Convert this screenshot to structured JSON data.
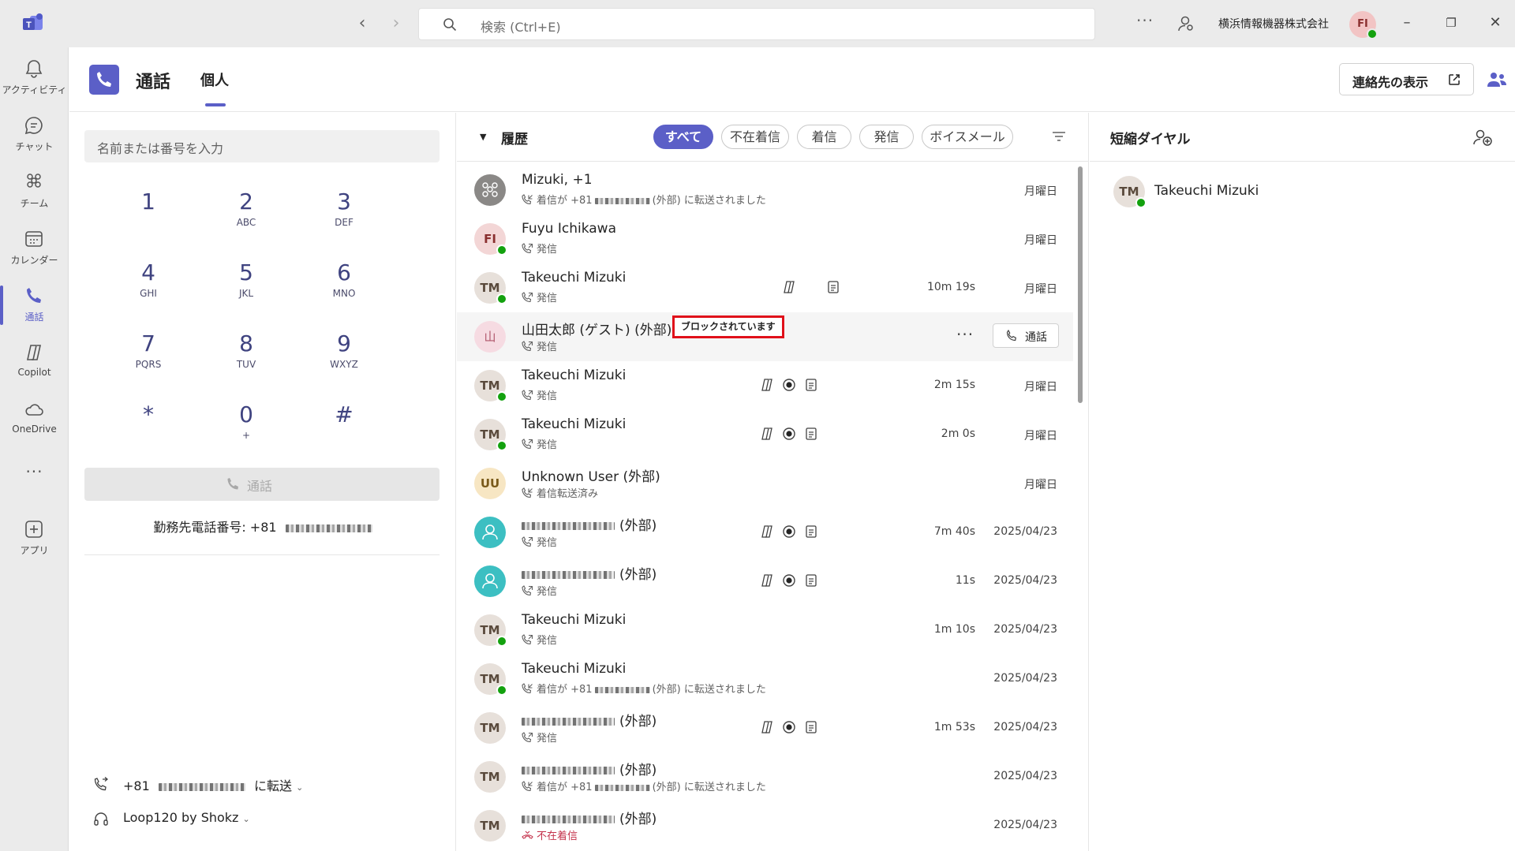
{
  "titlebar": {
    "search_placeholder": "検索 (Ctrl+E)",
    "org_name": "横浜情報機器株式会社",
    "avatar_initials": "FI"
  },
  "rail": {
    "items": [
      {
        "label": "アクティビティ",
        "icon": "bell-icon"
      },
      {
        "label": "チャット",
        "icon": "chat-icon"
      },
      {
        "label": "チーム",
        "icon": "teams-icon"
      },
      {
        "label": "カレンダー",
        "icon": "calendar-icon"
      },
      {
        "label": "通話",
        "icon": "phone-icon",
        "active": true
      },
      {
        "label": "Copilot",
        "icon": "copilot-icon"
      },
      {
        "label": "OneDrive",
        "icon": "cloud-icon"
      },
      {
        "label": "アプリ",
        "icon": "add-app-icon"
      }
    ],
    "more": "..."
  },
  "header": {
    "title": "通話",
    "tab": "個人",
    "show_contacts": "連絡先の表示"
  },
  "dialpad": {
    "placeholder": "名前または番号を入力",
    "keys": [
      {
        "d": "1",
        "l": ""
      },
      {
        "d": "2",
        "l": "ABC"
      },
      {
        "d": "3",
        "l": "DEF"
      },
      {
        "d": "4",
        "l": "GHI"
      },
      {
        "d": "5",
        "l": "JKL"
      },
      {
        "d": "6",
        "l": "MNO"
      },
      {
        "d": "7",
        "l": "PQRS"
      },
      {
        "d": "8",
        "l": "TUV"
      },
      {
        "d": "9",
        "l": "WXYZ"
      },
      {
        "d": "*",
        "l": ""
      },
      {
        "d": "0",
        "l": "+"
      },
      {
        "d": "#",
        "l": ""
      }
    ],
    "call_label": "通話",
    "work_number_label": "勤務先電話番号: +81",
    "forward_prefix": "+81",
    "forward_suffix": "に転送",
    "device": "Loop120 by Shokz"
  },
  "history": {
    "title": "履歴",
    "filters": [
      "すべて",
      "不在着信",
      "着信",
      "発信",
      "ボイスメール"
    ],
    "rows": [
      {
        "initials": "",
        "avatar_type": "group",
        "name": "Mizuki, +1",
        "sub": "着信が +81",
        "sub_tail": "(外部) に転送されました",
        "sub_blur": true,
        "dir": "in",
        "date": "月曜日",
        "duration": "",
        "icons": []
      },
      {
        "initials": "FI",
        "avatar_type": "fi",
        "name": "Fuyu Ichikawa",
        "sub": "発信",
        "dir": "out",
        "date": "月曜日",
        "duration": "",
        "icons": [],
        "status": true
      },
      {
        "initials": "TM",
        "avatar_type": "tm",
        "name": "Takeuchi Mizuki",
        "sub": "発信",
        "dir": "out",
        "date": "月曜日",
        "duration": "10m 19s",
        "icons": [
          "copilot",
          "transcript"
        ],
        "status": true
      },
      {
        "initials": "山",
        "avatar_type": "guest",
        "name": "山田太郎 (ゲスト) (外部)",
        "sub": "発信",
        "dir": "out",
        "date": "",
        "duration": "",
        "icons": [],
        "blocked": "ブロックされています",
        "selected": true,
        "call_button": "通話"
      },
      {
        "initials": "TM",
        "avatar_type": "tm",
        "name": "Takeuchi Mizuki",
        "sub": "発信",
        "dir": "out",
        "date": "月曜日",
        "duration": "2m 15s",
        "icons": [
          "copilot",
          "record",
          "transcript"
        ],
        "status": true
      },
      {
        "initials": "TM",
        "avatar_type": "tm",
        "name": "Takeuchi Mizuki",
        "sub": "発信",
        "dir": "out",
        "date": "月曜日",
        "duration": "2m 0s",
        "icons": [
          "copilot",
          "record",
          "transcript"
        ],
        "status": true
      },
      {
        "initials": "UU",
        "avatar_type": "uu",
        "name": "Unknown User (外部)",
        "sub": "着信転送済み",
        "dir": "in",
        "date": "月曜日",
        "duration": "",
        "icons": []
      },
      {
        "initials": "",
        "avatar_type": "person",
        "name": "(外部)",
        "name_blur": true,
        "sub": "発信",
        "dir": "out",
        "date": "2025/04/23",
        "duration": "7m 40s",
        "icons": [
          "copilot",
          "record",
          "transcript"
        ]
      },
      {
        "initials": "",
        "avatar_type": "person",
        "name": "(外部)",
        "name_blur": true,
        "sub": "発信",
        "dir": "out",
        "date": "2025/04/23",
        "duration": "11s",
        "icons": [
          "copilot",
          "record",
          "transcript"
        ]
      },
      {
        "initials": "TM",
        "avatar_type": "tm",
        "name": "Takeuchi Mizuki",
        "sub": "発信",
        "dir": "out",
        "date": "2025/04/23",
        "duration": "1m 10s",
        "icons": [],
        "status": true
      },
      {
        "initials": "TM",
        "avatar_type": "tm",
        "name": "Takeuchi Mizuki",
        "sub": "着信が +81",
        "sub_tail": "(外部) に転送されました",
        "sub_blur": true,
        "dir": "in",
        "date": "2025/04/23",
        "duration": "",
        "icons": [],
        "status": true
      },
      {
        "initials": "TM",
        "avatar_type": "tm",
        "name": "(外部)",
        "name_blur": true,
        "sub": "発信",
        "dir": "out",
        "date": "2025/04/23",
        "duration": "1m 53s",
        "icons": [
          "copilot",
          "record",
          "transcript"
        ]
      },
      {
        "initials": "TM",
        "avatar_type": "tm",
        "name": "(外部)",
        "name_blur": true,
        "sub": "着信が +81",
        "sub_tail": "(外部) に転送されました",
        "sub_blur": true,
        "dir": "in",
        "date": "2025/04/23",
        "duration": "",
        "icons": []
      },
      {
        "initials": "TM",
        "avatar_type": "tm",
        "name": "(外部)",
        "name_blur": true,
        "sub": "不在着信",
        "dir": "missed",
        "date": "2025/04/23",
        "duration": "",
        "icons": []
      }
    ]
  },
  "speed_dial": {
    "title": "短縮ダイヤル",
    "items": [
      {
        "initials": "TM",
        "name": "Takeuchi Mizuki"
      }
    ]
  },
  "colors": {
    "accent": "#5b5fc7",
    "presence_available": "#13a10e",
    "missed": "#c4314b",
    "blocked_border": "#e0101a"
  }
}
